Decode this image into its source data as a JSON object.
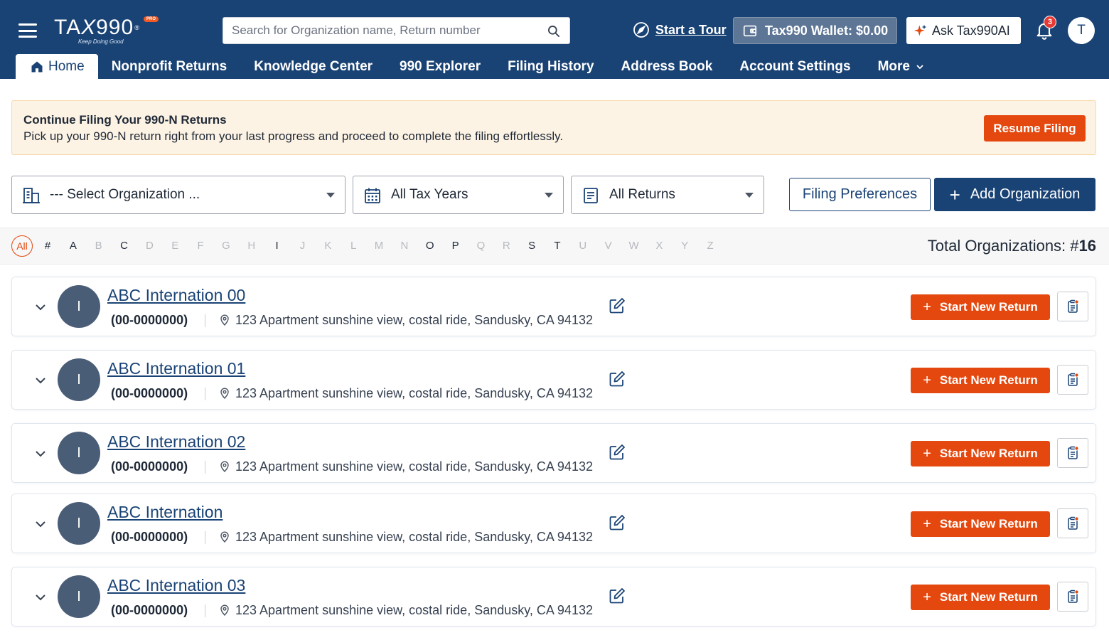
{
  "brand": {
    "name_left": "TA",
    "name_x": "X",
    "name_right": "990",
    "reg": "®",
    "badge": "PRO",
    "tagline": "Keep Doing Good"
  },
  "search": {
    "placeholder": "Search for Organization name, Return number",
    "icon": "search-icon"
  },
  "header": {
    "tour_label": "Start a Tour",
    "wallet_label": "Tax990 Wallet: $0.00",
    "ask_label": "Ask Tax990AI",
    "notification_count": "3",
    "user_initial": "T"
  },
  "nav": {
    "items": [
      {
        "label": "Home"
      },
      {
        "label": "Nonprofit Returns"
      },
      {
        "label": "Knowledge Center"
      },
      {
        "label": "990 Explorer"
      },
      {
        "label": "Filing History"
      },
      {
        "label": "Address Book"
      },
      {
        "label": "Account Settings"
      },
      {
        "label": "More"
      }
    ]
  },
  "banner": {
    "title": "Continue Filing Your 990-N Returns",
    "text": "Pick up your 990-N return right from your last progress and proceed to complete the filing effortlessly.",
    "button": "Resume Filing"
  },
  "filters": {
    "organization": "--- Select Organization ...",
    "tax_years": "All Tax Years",
    "returns": "All Returns",
    "preferences_button": "Filing Preferences",
    "add_button": "Add Organization",
    "add_plus": "+"
  },
  "alphabet": {
    "all_label": "All",
    "letters": [
      {
        "ch": "#",
        "active": true
      },
      {
        "ch": "A",
        "active": true
      },
      {
        "ch": "B",
        "active": false
      },
      {
        "ch": "C",
        "active": true
      },
      {
        "ch": "D",
        "active": false
      },
      {
        "ch": "E",
        "active": false
      },
      {
        "ch": "F",
        "active": false
      },
      {
        "ch": "G",
        "active": false
      },
      {
        "ch": "H",
        "active": false
      },
      {
        "ch": "I",
        "active": true
      },
      {
        "ch": "J",
        "active": false
      },
      {
        "ch": "K",
        "active": false
      },
      {
        "ch": "L",
        "active": false
      },
      {
        "ch": "M",
        "active": false
      },
      {
        "ch": "N",
        "active": false
      },
      {
        "ch": "O",
        "active": true
      },
      {
        "ch": "P",
        "active": true
      },
      {
        "ch": "Q",
        "active": false
      },
      {
        "ch": "R",
        "active": false
      },
      {
        "ch": "S",
        "active": true
      },
      {
        "ch": "T",
        "active": true
      },
      {
        "ch": "U",
        "active": false
      },
      {
        "ch": "V",
        "active": false
      },
      {
        "ch": "W",
        "active": false
      },
      {
        "ch": "X",
        "active": false
      },
      {
        "ch": "Y",
        "active": false
      },
      {
        "ch": "Z",
        "active": false
      }
    ],
    "total_label": "Total Organizations: #",
    "total_count": "16"
  },
  "organizations": [
    {
      "initial": "I",
      "name": "ABC Internation 00",
      "ein": "(00-0000000)",
      "address": "123 Apartment sunshine view, costal ride, Sandusky, CA 94132",
      "action": "Start New Return",
      "action_plus": "+"
    },
    {
      "initial": "I",
      "name": "ABC Internation 01",
      "ein": "(00-0000000)",
      "address": "123 Apartment sunshine view, costal ride, Sandusky, CA 94132",
      "action": "Start New Return",
      "action_plus": "+"
    },
    {
      "initial": "I",
      "name": "ABC Internation 02",
      "ein": "(00-0000000)",
      "address": "123 Apartment sunshine view, costal ride, Sandusky, CA 94132",
      "action": "Start New Return",
      "action_plus": "+"
    },
    {
      "initial": "I",
      "name": "ABC Internation",
      "ein": "(00-0000000)",
      "address": "123 Apartment sunshine view, costal ride, Sandusky, CA 94132",
      "action": "Start New Return",
      "action_plus": "+"
    },
    {
      "initial": "I",
      "name": "ABC Internation 03",
      "ein": "(00-0000000)",
      "address": "123 Apartment sunshine view, costal ride, Sandusky, CA 94132",
      "action": "Start New Return",
      "action_plus": "+"
    }
  ],
  "colors": {
    "header_bg": "#1a4375",
    "accent_orange": "#e4480e",
    "banner_bg": "#fdf3e4",
    "avatar_bg": "#4a5d77"
  }
}
